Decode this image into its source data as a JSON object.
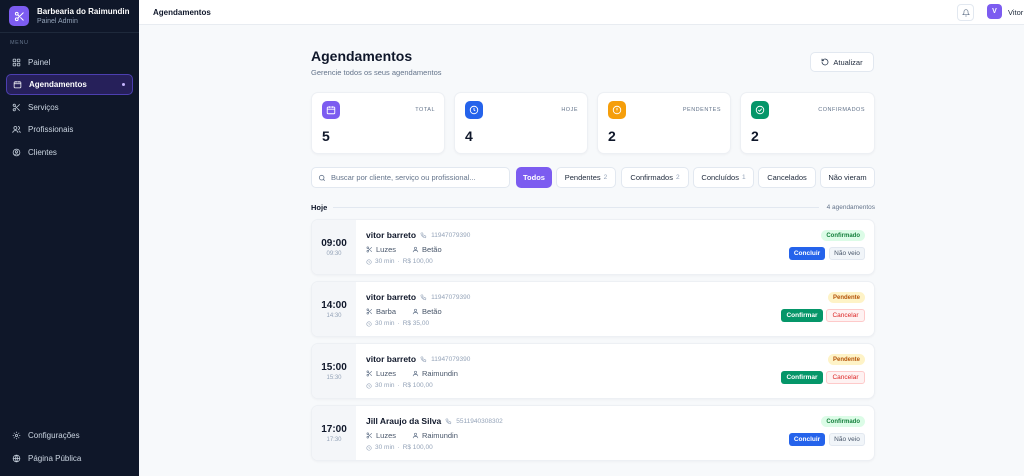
{
  "brand": {
    "name": "Barbearia do Raimundin",
    "subtitle": "Painel Admin",
    "icon": "scissors-icon"
  },
  "sidebar": {
    "menu_label": "MENU",
    "items": [
      {
        "label": "Painel",
        "icon": "grid-icon"
      },
      {
        "label": "Agendamentos",
        "icon": "calendar-icon",
        "active": true
      },
      {
        "label": "Serviços",
        "icon": "scissors-icon"
      },
      {
        "label": "Profissionais",
        "icon": "users-icon"
      },
      {
        "label": "Clientes",
        "icon": "user-circle-icon"
      }
    ],
    "bottom_items": [
      {
        "label": "Configurações",
        "icon": "gear-icon"
      },
      {
        "label": "Página Pública",
        "icon": "globe-icon"
      }
    ]
  },
  "topbar": {
    "title": "Agendamentos",
    "avatar_initial": "V",
    "user_name": "Vitor"
  },
  "page": {
    "title": "Agendamentos",
    "subtitle": "Gerencie todos os seus agendamentos",
    "refresh_label": "Atualizar"
  },
  "stats": [
    {
      "label": "TOTAL",
      "value": "5",
      "color": "#7c5cf0",
      "icon": "calendar-icon"
    },
    {
      "label": "HOJE",
      "value": "4",
      "color": "#2563eb",
      "icon": "clock-icon"
    },
    {
      "label": "PENDENTES",
      "value": "2",
      "color": "#f59e0b",
      "icon": "alert-circle-icon"
    },
    {
      "label": "CONFIRMADOS",
      "value": "2",
      "color": "#059669",
      "icon": "check-circle-icon"
    }
  ],
  "search": {
    "placeholder": "Buscar por cliente, serviço ou profissional..."
  },
  "filters": [
    {
      "label": "Todos",
      "count": "",
      "active": true
    },
    {
      "label": "Pendentes",
      "count": "2"
    },
    {
      "label": "Confirmados",
      "count": "2"
    },
    {
      "label": "Concluídos",
      "count": "1"
    },
    {
      "label": "Cancelados",
      "count": ""
    },
    {
      "label": "Não vieram",
      "count": ""
    }
  ],
  "section": {
    "title": "Hoje",
    "count_text": "4 agendamentos"
  },
  "appointments": [
    {
      "time": "09:00",
      "time_small": "09:30",
      "client": "vitor barreto",
      "phone": "11947079390",
      "service": "Luzes",
      "professional": "Betão",
      "duration": "30 min",
      "price": "R$ 100,00",
      "status": "Confirmado",
      "primary_action": "Concluir",
      "secondary_action": "Não veio"
    },
    {
      "time": "14:00",
      "time_small": "14:30",
      "client": "vitor barreto",
      "phone": "11947079390",
      "service": "Barba",
      "professional": "Betão",
      "duration": "30 min",
      "price": "R$ 35,00",
      "status": "Pendente",
      "primary_action": "Confirmar",
      "secondary_action": "Cancelar"
    },
    {
      "time": "15:00",
      "time_small": "15:30",
      "client": "vitor barreto",
      "phone": "11947079390",
      "service": "Luzes",
      "professional": "Raimundin",
      "duration": "30 min",
      "price": "R$ 100,00",
      "status": "Pendente",
      "primary_action": "Confirmar",
      "secondary_action": "Cancelar"
    },
    {
      "time": "17:00",
      "time_small": "17:30",
      "client": "Jill Araujo da Silva",
      "phone": "5511940308302",
      "service": "Luzes",
      "professional": "Raimundin",
      "duration": "30 min",
      "price": "R$ 100,00",
      "status": "Confirmado",
      "primary_action": "Concluir",
      "secondary_action": "Não veio"
    }
  ]
}
